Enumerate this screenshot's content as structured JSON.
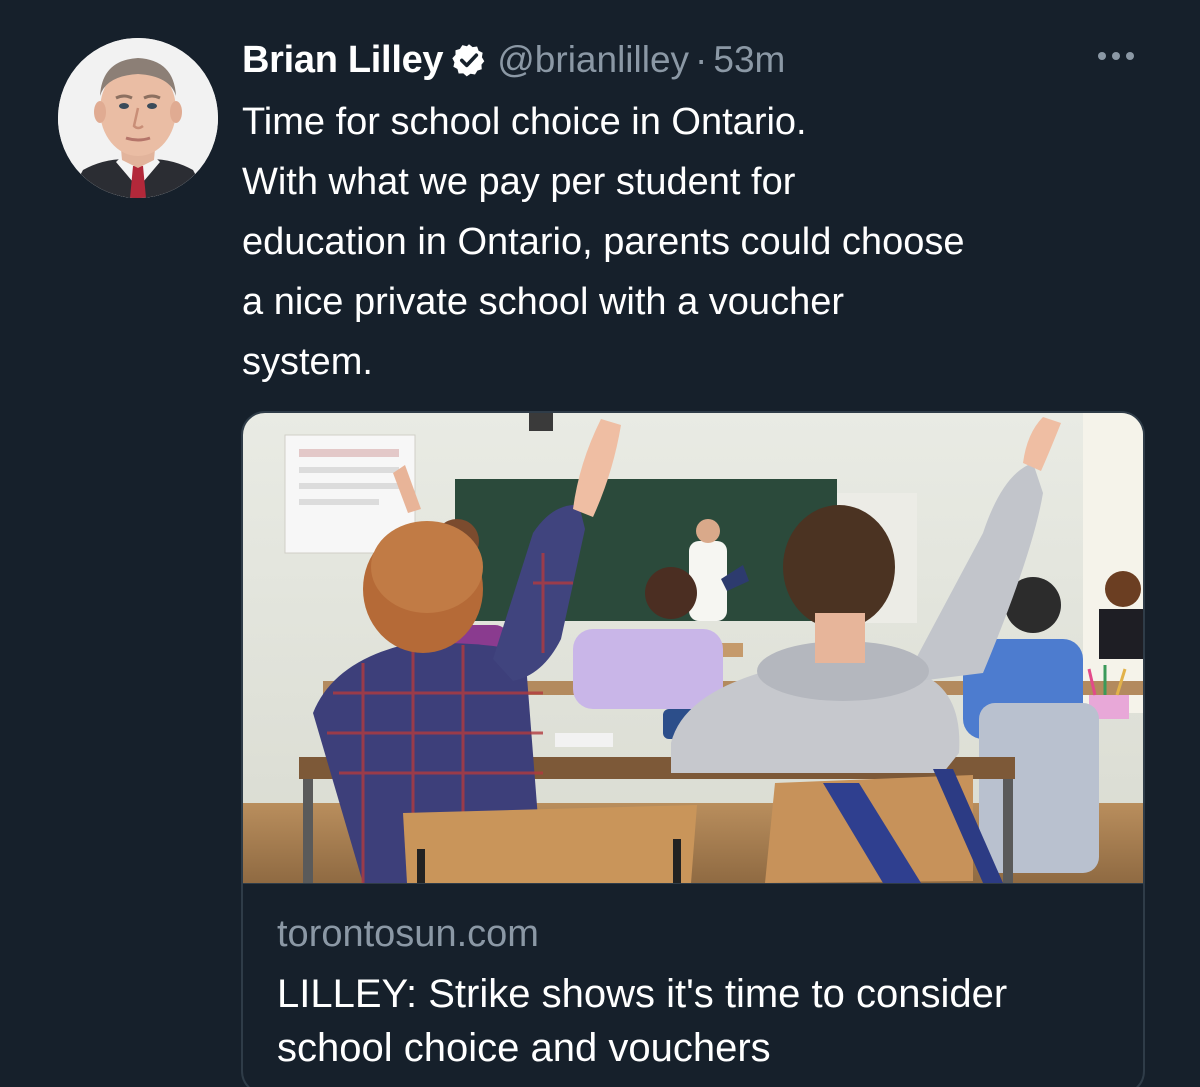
{
  "author": {
    "name": "Brian Lilley",
    "handle": "@brianlilley",
    "separator": "·",
    "time": "53m",
    "verified": true,
    "avatar_icon": "profile-photo"
  },
  "tweet": {
    "text": "Time for school choice in Ontario.\nWith what we pay per student for\neducation in Ontario, parents could choose\na nice private school with a voucher\nsystem."
  },
  "link_card": {
    "domain": "torontosun.com",
    "title": "LILLEY: Strike shows it's time to consider school choice and vouchers",
    "image_icon": "classroom-photo"
  },
  "icons": {
    "verified": "verified-badge-icon",
    "more": "more-options-icon"
  },
  "colors": {
    "background": "#16202b",
    "text_primary": "#ffffff",
    "text_secondary": "#8b98a5",
    "card_border": "#2f3c48"
  }
}
